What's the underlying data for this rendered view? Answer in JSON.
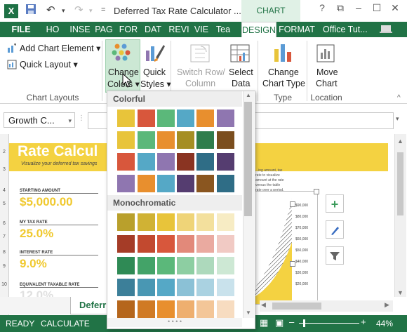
{
  "app": {
    "title": "Deferred Tax Rate Calculator ...",
    "chart_tools_label": "CHART TOOLS",
    "user": "Office Tut..."
  },
  "tabs": [
    "FILE",
    "HO",
    "INSE",
    "PAG",
    "FOR",
    "DAT",
    "REVI",
    "VIE",
    "Tea",
    "DESIGN",
    "FORMAT"
  ],
  "ribbon": {
    "add_chart_element": "Add Chart Element",
    "quick_layout": "Quick Layout",
    "chart_layouts_label": "Chart Layouts",
    "change_colors_line1": "Change",
    "change_colors_line2": "Colors",
    "quick_styles_line1": "Quick",
    "quick_styles_line2": "Styles",
    "switch_row_line1": "Switch Row/",
    "switch_row_line2": "Column",
    "select_data_line1": "Select",
    "select_data_line2": "Data",
    "change_chart_type_line1": "Change",
    "change_chart_type_line2": "Chart Type",
    "type_label": "Type",
    "move_chart_line1": "Move",
    "move_chart_line2": "Chart",
    "location_label": "Location"
  },
  "name_box": "Growth C...",
  "sheet": {
    "rows": [
      "2",
      "3",
      "4",
      "5",
      "6",
      "7",
      "8",
      "9",
      "10"
    ],
    "banner_title": "Rate Calcul",
    "banner_subtitle": "Visualize your deferred tax savings",
    "fields": [
      {
        "label": "STARTING AMOUNT",
        "value": "$5,000.00"
      },
      {
        "label": "MY TAX RATE",
        "value": "25.0%"
      },
      {
        "label": "INTEREST RATE",
        "value": "9.0%"
      },
      {
        "label": "EQUIVALENT TAXABLE RATE",
        "value": "12.0%"
      }
    ],
    "note": "...ing amount, tax rate to visualize amount at the rate versus the table rate over a period.",
    "axis_labels": [
      "$90,000",
      "$80,000",
      "$70,000",
      "$60,000",
      "$50,000",
      "$40,000",
      "$30,000",
      "$20,000"
    ],
    "sheet_tab": "Deferr"
  },
  "status": {
    "ready": "READY",
    "calculate": "CALCULATE",
    "zoom": "44%"
  },
  "dropdown": {
    "colorful_label": "Colorful",
    "monochromatic_label": "Monochromatic",
    "colorful": [
      [
        "#e8c43a",
        "#d8573c",
        "#5bb87a",
        "#55a8c6",
        "#e88f2e",
        "#8f76b0"
      ],
      [
        "#e8c43a",
        "#5bb87a",
        "#e88f2e",
        "#a58e23",
        "#2f7d4c",
        "#7b4e1e"
      ],
      [
        "#d8573c",
        "#55a8c6",
        "#8f76b0",
        "#8a3422",
        "#2f6d86",
        "#553d70"
      ],
      [
        "#8f76b0",
        "#e88f2e",
        "#55a8c6",
        "#553d70",
        "#8a5620",
        "#2f6d86"
      ]
    ],
    "monochromatic": [
      [
        "#b9a02c",
        "#d0b234",
        "#e8c43a",
        "#efd478",
        "#f3e09d",
        "#f7ecc4"
      ],
      [
        "#a53c27",
        "#c2492f",
        "#d8573c",
        "#e2897a",
        "#eaaaa0",
        "#f1cac4"
      ],
      [
        "#2f8a55",
        "#43a368",
        "#5bb87a",
        "#8dcea2",
        "#add9bc",
        "#cde8d4"
      ],
      [
        "#3c7f99",
        "#4997b3",
        "#55a8c6",
        "#8bc1d6",
        "#aad2e1",
        "#c9e2ec"
      ],
      [
        "#b5661c",
        "#d07a24",
        "#e88f2e",
        "#eeaf6f",
        "#f3c698",
        "#f7dcc0"
      ]
    ]
  }
}
